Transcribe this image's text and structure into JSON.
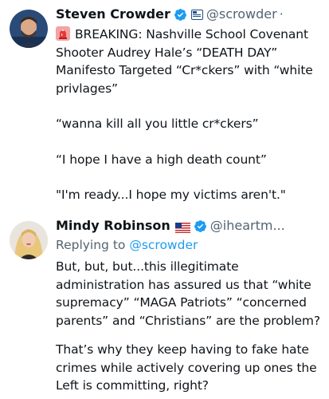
{
  "tweet1": {
    "name": "Steven Crowder",
    "handle": "@scrowder",
    "dot": "·",
    "lines": [
      "BREAKING: Nashville School Covenant",
      "Shooter Audrey Hale’s “DEATH DAY”",
      "Manifesto Targeted “Cr*ckers” with “white",
      "privlages”"
    ],
    "quote1": "“wanna kill all you little cr*ckers”",
    "quote2": "“I hope I have a high death count”",
    "quote3": "\"I'm ready...I hope my victims aren't.\""
  },
  "tweet2": {
    "name": "Mindy Robinson",
    "handle": "@iheartm...",
    "replying_prefix": "Replying to ",
    "replying_mention": "@scrowder",
    "para1": [
      "But, but, but...this illegitimate",
      "administration has assured us that “white",
      "supremacy” “MAGA Patriots” “concerned",
      "parents” and “Christians” are the problem?"
    ],
    "para2": [
      "That’s why they keep having to fake hate",
      "crimes while actively covering up ones the",
      "Left is committing, right?"
    ]
  },
  "icons": {
    "verified": "verified-badge-icon",
    "siren": "rotating-light-icon",
    "org": "affiliation-badge-icon",
    "flag": "us-flag-icon"
  },
  "colors": {
    "verified": "#1d9bf0",
    "secondary_text": "#536471",
    "link": "#1d9bf0"
  }
}
